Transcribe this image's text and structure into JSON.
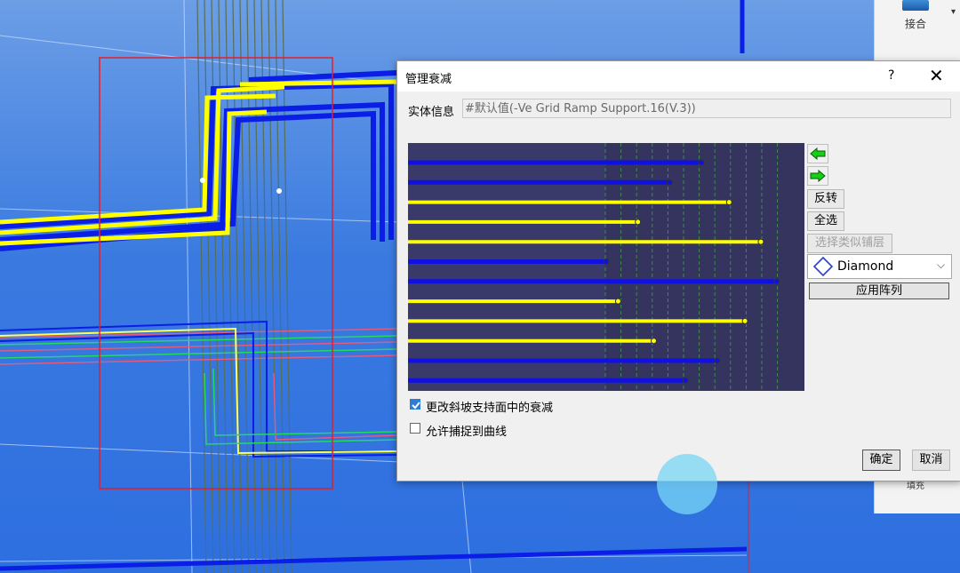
{
  "right_panel": {
    "join_label": "接合",
    "fill_label": "填充"
  },
  "dialog": {
    "title": "管理衰减",
    "help": "?",
    "close": "✕",
    "entity_label": "实体信息",
    "entity_value": "#默认值(-Ve Grid Ramp Support.16(V.3))",
    "buttons": {
      "reverse": "反转",
      "select_all": "全选",
      "select_similar": "选择类似铺层",
      "apply_array": "应用阵列",
      "ok": "确定",
      "cancel": "取消"
    },
    "dropdown": {
      "selected": "Diamond",
      "icon": "diamond-icon"
    },
    "checkboxes": {
      "change_ramp": {
        "label": "更改斜坡支持面中的衰减",
        "checked": true
      },
      "allow_snap": {
        "label": "允许捕捉到曲线",
        "checked": false
      }
    },
    "preview_plies": [
      {
        "color": "#1010e0",
        "length": 0.74
      },
      {
        "color": "#1010e0",
        "length": 0.66
      },
      {
        "color": "#ffff00",
        "length": 0.81
      },
      {
        "color": "#ffff00",
        "length": 0.58
      },
      {
        "color": "#ffff00",
        "length": 0.89
      },
      {
        "color": "#1010e0",
        "length": 0.5
      },
      {
        "color": "#1010e0",
        "length": 0.93
      },
      {
        "color": "#ffff00",
        "length": 0.53
      },
      {
        "color": "#ffff00",
        "length": 0.85
      },
      {
        "color": "#ffff00",
        "length": 0.62
      },
      {
        "color": "#1010e0",
        "length": 0.78
      },
      {
        "color": "#1010e0",
        "length": 0.7
      }
    ]
  }
}
